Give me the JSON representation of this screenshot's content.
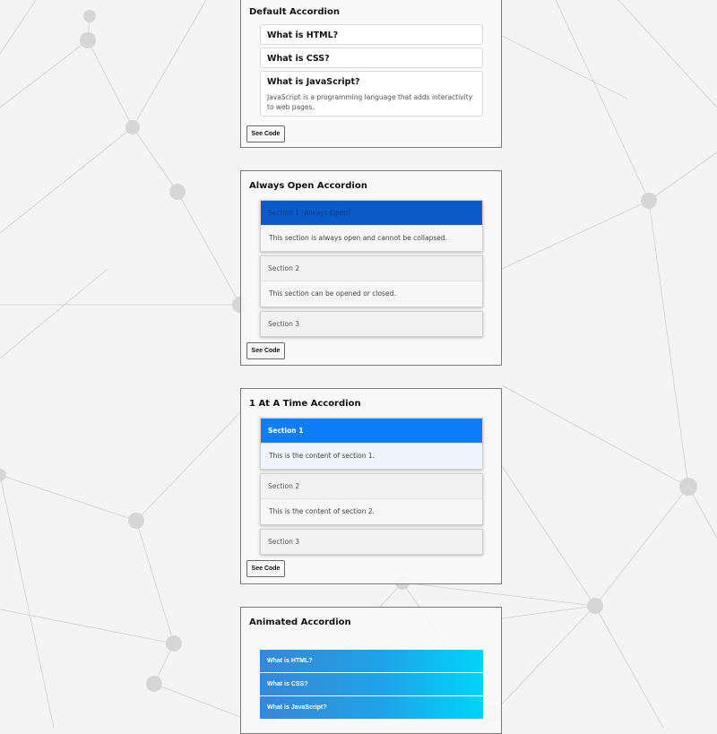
{
  "see_code_label": "See Code",
  "default_accordion": {
    "title": "Default Accordion",
    "items": [
      {
        "question": "What is HTML?"
      },
      {
        "question": "What is CSS?"
      },
      {
        "question": "What is JavaScript?",
        "answer": "JavaScript is a programming language that adds interactivity to web pages."
      }
    ]
  },
  "always_open_accordion": {
    "title": "Always Open Accordion",
    "items": [
      {
        "header": "Section 1 (Always Open)",
        "content": "This section is always open and cannot be collapsed."
      },
      {
        "header": "Section 2",
        "content": "This section can be opened or closed."
      },
      {
        "header": "Section 3"
      }
    ]
  },
  "one_at_a_time_accordion": {
    "title": "1 At A Time Accordion",
    "items": [
      {
        "header": "Section 1",
        "content": "This is the content of section 1."
      },
      {
        "header": "Section 2",
        "content": "This is the content of section 2."
      },
      {
        "header": "Section 3"
      }
    ]
  },
  "animated_accordion": {
    "title": "Animated Accordion",
    "items": [
      {
        "header": "What is HTML?"
      },
      {
        "header": "What is CSS?"
      },
      {
        "header": "What is JavaScript?"
      }
    ]
  },
  "colors": {
    "always_open_active": "#0a5ac8",
    "one_at_a_time_active": "#0d7ef8",
    "animated_gradient_start": "#3a86d6",
    "animated_gradient_end": "#00d4fb"
  }
}
